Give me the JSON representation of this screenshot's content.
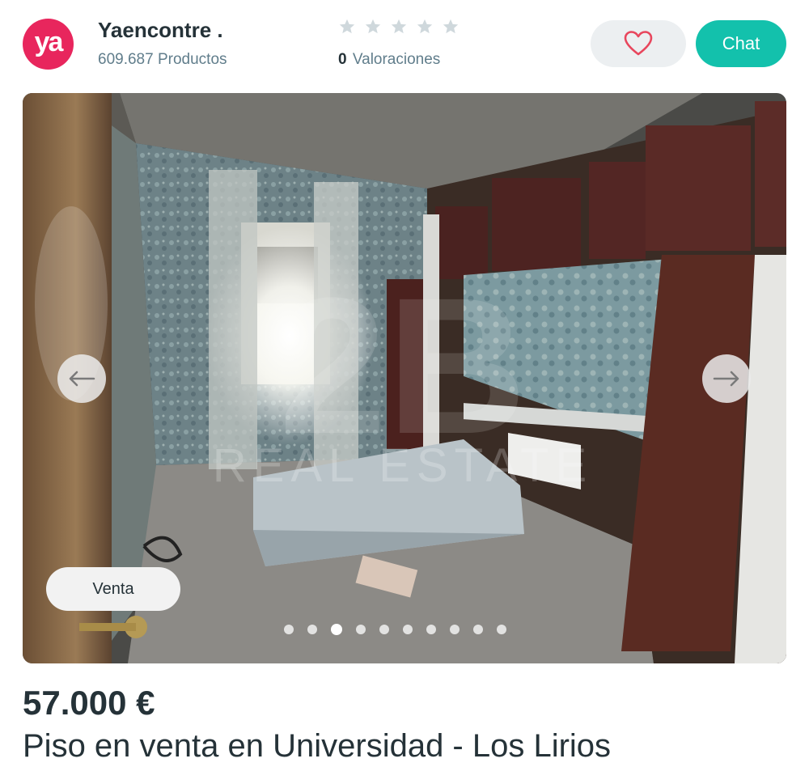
{
  "seller": {
    "logo_text": "ya",
    "name": "Yaencontre .",
    "products": "609.687 Productos"
  },
  "rating": {
    "count": "0",
    "label": "Valoraciones",
    "stars_total": 5,
    "stars_filled": 0
  },
  "actions": {
    "chat_label": "Chat"
  },
  "gallery": {
    "badge": "Venta",
    "watermark_text": "REAL ESTATE",
    "image_count": 10,
    "current_index": 3
  },
  "listing": {
    "price": "57.000 €",
    "title": "Piso en venta en Universidad - Los Lirios"
  },
  "colors": {
    "brand": "#e8265d",
    "accent": "#13c1ac",
    "text": "#253238",
    "muted": "#607d8b"
  },
  "icons": [
    "heart-icon",
    "arrow-left-icon",
    "arrow-right-icon",
    "star-icon"
  ]
}
